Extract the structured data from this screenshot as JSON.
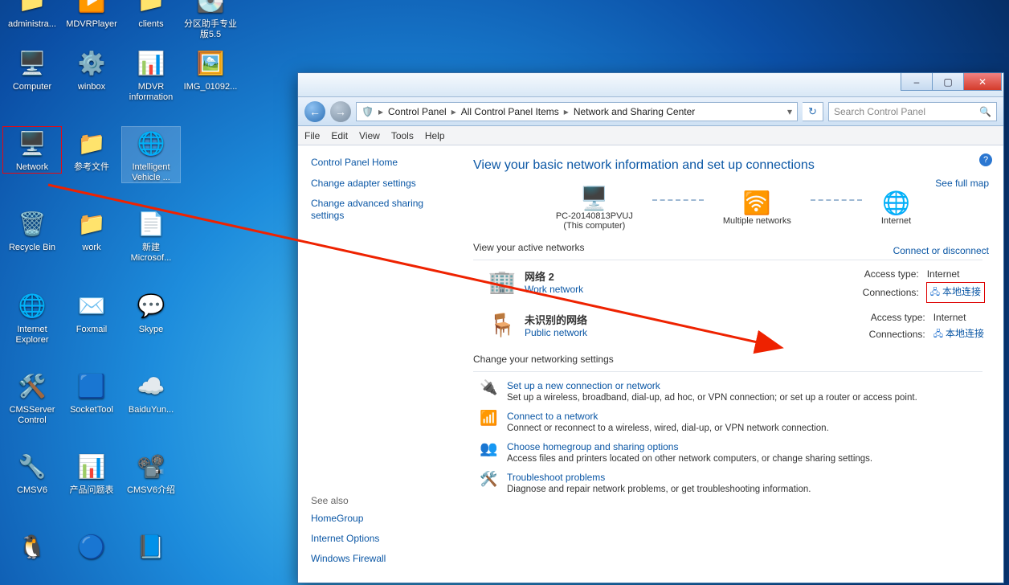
{
  "desktop_icons": [
    {
      "row": 0,
      "col": 0,
      "label": "administra...",
      "glyph": "📁"
    },
    {
      "row": 0,
      "col": 1,
      "label": "MDVRPlayer",
      "glyph": "▶️"
    },
    {
      "row": 0,
      "col": 2,
      "label": "clients",
      "glyph": "📁"
    },
    {
      "row": 0,
      "col": 3,
      "label": "分区助手专业版5.5",
      "glyph": "💽"
    },
    {
      "row": 1,
      "col": 0,
      "label": "Computer",
      "glyph": "🖥️"
    },
    {
      "row": 1,
      "col": 1,
      "label": "winbox",
      "glyph": "⚙️"
    },
    {
      "row": 1,
      "col": 2,
      "label": "MDVR information",
      "glyph": "📊"
    },
    {
      "row": 1,
      "col": 3,
      "label": "IMG_01092...",
      "glyph": "🖼️"
    },
    {
      "row": 2,
      "col": 0,
      "label": "Network",
      "glyph": "🖥️",
      "box": true
    },
    {
      "row": 2,
      "col": 1,
      "label": "参考文件",
      "glyph": "📁"
    },
    {
      "row": 2,
      "col": 2,
      "label": "Intelligent Vehicle ...",
      "glyph": "🌐",
      "sel": true
    },
    {
      "row": 3,
      "col": 0,
      "label": "Recycle Bin",
      "glyph": "🗑️"
    },
    {
      "row": 3,
      "col": 1,
      "label": "work",
      "glyph": "📁"
    },
    {
      "row": 3,
      "col": 2,
      "label": "新建 Microsof...",
      "glyph": "📄"
    },
    {
      "row": 4,
      "col": 0,
      "label": "Internet Explorer",
      "glyph": "🌐"
    },
    {
      "row": 4,
      "col": 1,
      "label": "Foxmail",
      "glyph": "✉️"
    },
    {
      "row": 4,
      "col": 2,
      "label": "Skype",
      "glyph": "💬"
    },
    {
      "row": 5,
      "col": 0,
      "label": "CMSServer Control",
      "glyph": "🛠️"
    },
    {
      "row": 5,
      "col": 1,
      "label": "SocketTool",
      "glyph": "🟦"
    },
    {
      "row": 5,
      "col": 2,
      "label": "BaiduYun...",
      "glyph": "☁️"
    },
    {
      "row": 6,
      "col": 0,
      "label": "CMSV6",
      "glyph": "🔧"
    },
    {
      "row": 6,
      "col": 1,
      "label": "产品问题表",
      "glyph": "📊"
    },
    {
      "row": 6,
      "col": 2,
      "label": "CMSV6介绍",
      "glyph": "📽️"
    },
    {
      "row": 7,
      "col": 0,
      "label": "",
      "glyph": "🐧"
    },
    {
      "row": 7,
      "col": 1,
      "label": "",
      "glyph": "🔵"
    },
    {
      "row": 7,
      "col": 2,
      "label": "",
      "glyph": "📘"
    }
  ],
  "breadcrumb": {
    "p1": "Control Panel",
    "p2": "All Control Panel Items",
    "p3": "Network and Sharing Center"
  },
  "search": {
    "placeholder": "Search Control Panel"
  },
  "menu": {
    "file": "File",
    "edit": "Edit",
    "view": "View",
    "tools": "Tools",
    "help": "Help"
  },
  "sidebar": {
    "head": "Control Panel Home",
    "links": [
      "Change adapter settings",
      "Change advanced sharing settings"
    ],
    "see_also": "See also",
    "see_links": [
      "HomeGroup",
      "Internet Options",
      "Windows Firewall"
    ]
  },
  "content": {
    "title": "View your basic network information and set up connections",
    "full_map": "See full map",
    "nodes": {
      "pc": "PC-20140813PVUJ",
      "pc_sub": "(This computer)",
      "multi": "Multiple networks",
      "internet": "Internet"
    },
    "active_title": "View your active networks",
    "connect_link": "Connect or disconnect",
    "net1": {
      "name": "网络 2",
      "type": "Work network",
      "access_l": "Access type:",
      "access_v": "Internet",
      "conn_l": "Connections:",
      "conn_v": "本地连接"
    },
    "net2": {
      "name": "未识别的网络",
      "type": "Public network",
      "access_l": "Access type:",
      "access_v": "Internet",
      "conn_l": "Connections:",
      "conn_v": "本地连接"
    },
    "change_title": "Change your networking settings",
    "tasks": [
      {
        "title": "Set up a new connection or network",
        "desc": "Set up a wireless, broadband, dial-up, ad hoc, or VPN connection; or set up a router or access point."
      },
      {
        "title": "Connect to a network",
        "desc": "Connect or reconnect to a wireless, wired, dial-up, or VPN network connection."
      },
      {
        "title": "Choose homegroup and sharing options",
        "desc": "Access files and printers located on other network computers, or change sharing settings."
      },
      {
        "title": "Troubleshoot problems",
        "desc": "Diagnose and repair network problems, or get troubleshooting information."
      }
    ]
  }
}
